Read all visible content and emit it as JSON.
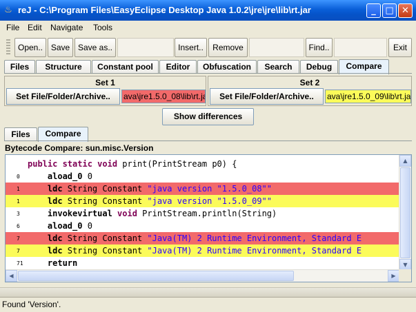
{
  "window": {
    "title": "reJ - C:\\Program Files\\EasyEclipse Desktop Java 1.0.2\\jre\\jre\\lib\\rt.jar",
    "minimize": "_",
    "maximize": "□",
    "close": "✕"
  },
  "menu": [
    "File",
    "Edit",
    "Navigate",
    "Tools"
  ],
  "toolbar": {
    "open": "Open..",
    "save": "Save",
    "save_as": "Save as..",
    "insert": "Insert..",
    "remove": "Remove",
    "find": "Find..",
    "exit": "Exit"
  },
  "tabs": [
    "Files",
    "Structure",
    "Constant pool",
    "Editor",
    "Obfuscation",
    "Search",
    "Debug",
    "Compare"
  ],
  "active_tab": "Compare",
  "set1": {
    "label": "Set 1",
    "button": "Set File/Folder/Archive..",
    "path": "ava\\jre1.5.0_08\\lib\\rt.jar",
    "color": "#f26a6a"
  },
  "set2": {
    "label": "Set 2",
    "button": "Set File/Folder/Archive..",
    "path": "ava\\jre1.5.0_09\\lib\\rt.jar",
    "color": "#fbfb5a"
  },
  "show_differences": "Show differences",
  "subtabs": [
    "Files",
    "Compare"
  ],
  "active_subtab": "Compare",
  "heading": "Bytecode Compare: sun.misc.Version",
  "code": [
    {
      "ln": "",
      "bg": "#ffffff",
      "parts": [
        {
          "t": "public static void ",
          "c": "kw"
        },
        {
          "t": "print(PrintStream p0) {",
          "c": ""
        }
      ]
    },
    {
      "ln": "0",
      "bg": "#ffffff",
      "parts": [
        {
          "t": "    aload_0 ",
          "c": "op"
        },
        {
          "t": "0",
          "c": ""
        }
      ]
    },
    {
      "ln": "1",
      "bg": "#f26a6a",
      "parts": [
        {
          "t": "    ldc ",
          "c": "op"
        },
        {
          "t": "String Constant ",
          "c": ""
        },
        {
          "t": "\"java version \"1.5.0_08\"\"",
          "c": "str"
        }
      ]
    },
    {
      "ln": "1",
      "bg": "#fbfb5a",
      "parts": [
        {
          "t": "    ldc ",
          "c": "op"
        },
        {
          "t": "String Constant ",
          "c": ""
        },
        {
          "t": "\"java version \"1.5.0_09\"\"",
          "c": "str"
        }
      ]
    },
    {
      "ln": "3",
      "bg": "#ffffff",
      "parts": [
        {
          "t": "    invokevirtual ",
          "c": "op"
        },
        {
          "t": "void ",
          "c": "kw"
        },
        {
          "t": "PrintStream.println(String)",
          "c": ""
        }
      ]
    },
    {
      "ln": "6",
      "bg": "#ffffff",
      "parts": [
        {
          "t": "    aload_0 ",
          "c": "op"
        },
        {
          "t": "0",
          "c": ""
        }
      ]
    },
    {
      "ln": "7",
      "bg": "#f26a6a",
      "parts": [
        {
          "t": "    ldc ",
          "c": "op"
        },
        {
          "t": "String Constant ",
          "c": ""
        },
        {
          "t": "\"Java(TM) 2 Runtime Environment, Standard E",
          "c": "str"
        }
      ]
    },
    {
      "ln": "7",
      "bg": "#fbfb5a",
      "parts": [
        {
          "t": "    ldc ",
          "c": "op"
        },
        {
          "t": "String Constant ",
          "c": ""
        },
        {
          "t": "\"Java(TM) 2 Runtime Environment, Standard E",
          "c": "str"
        }
      ]
    },
    {
      "ln": "71",
      "bg": "#ffffff",
      "parts": [
        {
          "t": "    return",
          "c": "op"
        }
      ]
    }
  ],
  "status": "Found 'Version'."
}
